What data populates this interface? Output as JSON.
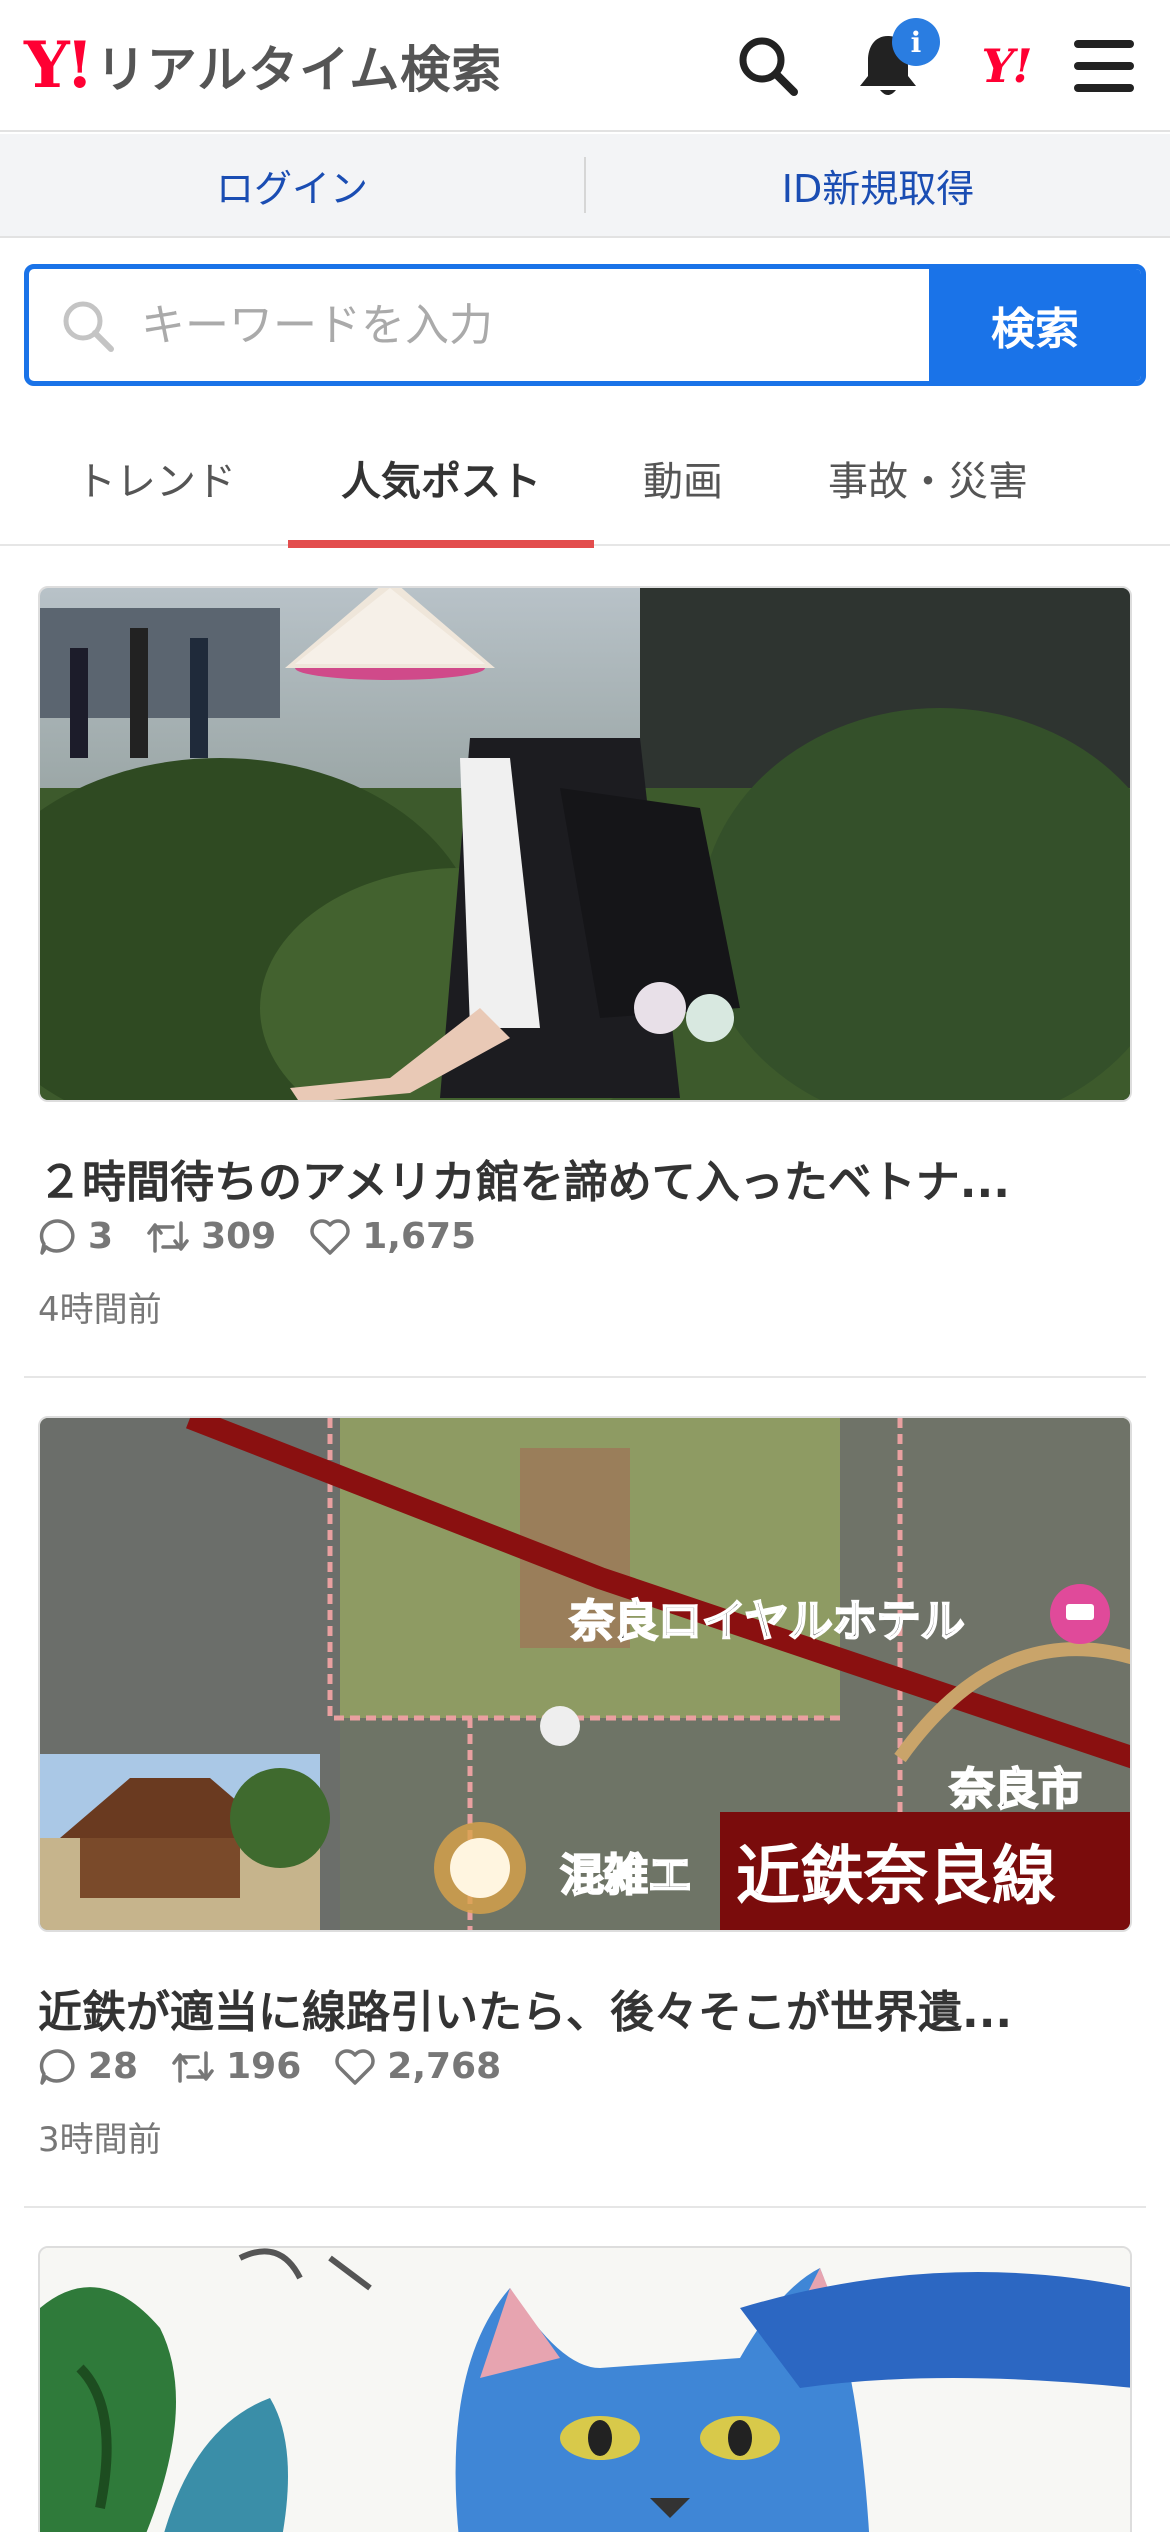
{
  "header": {
    "logo_mark": "Y!",
    "logo_text": "リアルタイム検索",
    "notification_badge": "i",
    "yahoo_mini": "Y!"
  },
  "loginbar": {
    "login": "ログイン",
    "register": "ID新規取得"
  },
  "search": {
    "placeholder": "キーワードを入力",
    "button": "検索"
  },
  "tabs": [
    {
      "label": "トレンド",
      "active": false
    },
    {
      "label": "人気ポスト",
      "active": true
    },
    {
      "label": "動画",
      "active": false
    },
    {
      "label": "事故・災害",
      "active": false
    }
  ],
  "posts": [
    {
      "title": "２時間待ちのアメリカ館を諦めて入ったベトナ...",
      "replies": "3",
      "reposts": "309",
      "likes": "1,675",
      "time": "4時間前"
    },
    {
      "title": "近鉄が適当に線路引いたら、後々そこが世界遺...",
      "replies": "28",
      "reposts": "196",
      "likes": "2,768",
      "time": "3時間前",
      "map_labels": {
        "line_name": "近鉄奈良線",
        "hotel": "奈良ロイヤルホテル",
        "congestion": "混雑エ",
        "city": "奈良市"
      }
    }
  ],
  "colors": {
    "accent": "#1a73e8",
    "brand_red": "#ff0033",
    "tab_indicator": "#e34d4d",
    "link": "#1a4db3"
  }
}
